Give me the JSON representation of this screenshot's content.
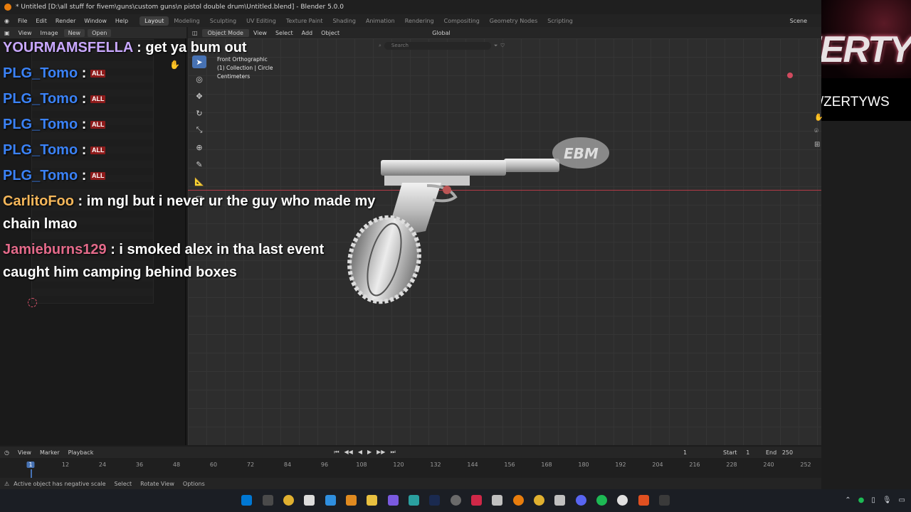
{
  "window": {
    "title": "* Untitled [D:\\all stuff for fivem\\guns\\custom guns\\n pistol double drum\\Untitled.blend] - Blender 5.0.0"
  },
  "menu": {
    "items": [
      "File",
      "Edit",
      "Render",
      "Window",
      "Help"
    ],
    "workspaces": [
      "Layout",
      "Modeling",
      "Sculpting",
      "UV Editing",
      "Texture Paint",
      "Shading",
      "Animation",
      "Rendering",
      "Compositing",
      "Geometry Nodes",
      "Scripting"
    ],
    "scene": "Scene"
  },
  "image_editor": {
    "view": "View",
    "image": "Image",
    "new": "New",
    "open": "Open"
  },
  "viewport_header": {
    "mode": "Object Mode",
    "view": "View",
    "select": "Select",
    "add": "Add",
    "object": "Object",
    "orientation": "Global"
  },
  "viewport": {
    "search_placeholder": "Search",
    "info_line1": "Front Orthographic",
    "info_line2": "(1) Collection | Circle",
    "info_line3": "Centimeters"
  },
  "chat": [
    {
      "user": "YOURMAMSFELLA",
      "color": "#c9a8ff",
      "message": "get ya bum out",
      "badge": ""
    },
    {
      "user": "PLG_Tomo",
      "color": "#3b82f6",
      "message": "",
      "badge": "ALL"
    },
    {
      "user": "PLG_Tomo",
      "color": "#3b82f6",
      "message": "",
      "badge": "ALL"
    },
    {
      "user": "PLG_Tomo",
      "color": "#3b82f6",
      "message": "",
      "badge": "ALL"
    },
    {
      "user": "PLG_Tomo",
      "color": "#3b82f6",
      "message": "",
      "badge": "ALL"
    },
    {
      "user": "PLG_Tomo",
      "color": "#3b82f6",
      "message": "",
      "badge": "ALL"
    },
    {
      "user": "CarlitoFoo",
      "color": "#f5b75a",
      "message": "im ngl but i never ur the guy who made my",
      "message2": "chain lmao",
      "badge": ""
    },
    {
      "user": "Jamieburns129",
      "color": "#e46a8a",
      "message": "i smoked alex in tha last event",
      "message2": "caught him camping behind boxes",
      "badge": ""
    }
  ],
  "brand": {
    "logo": "ZERTY",
    "url": ".GG/ZERTYWS"
  },
  "timeline": {
    "view": "View",
    "marker": "Marker",
    "playback": "Playback",
    "current_frame": "1",
    "start_label": "Start",
    "start": "1",
    "end_label": "End",
    "end": "250",
    "ticks": [
      "1",
      "12",
      "24",
      "36",
      "48",
      "60",
      "72",
      "84",
      "96",
      "108",
      "120",
      "132",
      "144",
      "156",
      "168",
      "180",
      "192",
      "204",
      "216",
      "228",
      "240",
      "252"
    ]
  },
  "status": {
    "warning": "Active object has negative scale",
    "select": "Select",
    "rotate": "Rotate View",
    "options": "Options"
  },
  "taskbar": {
    "accent": "#0078d4"
  }
}
